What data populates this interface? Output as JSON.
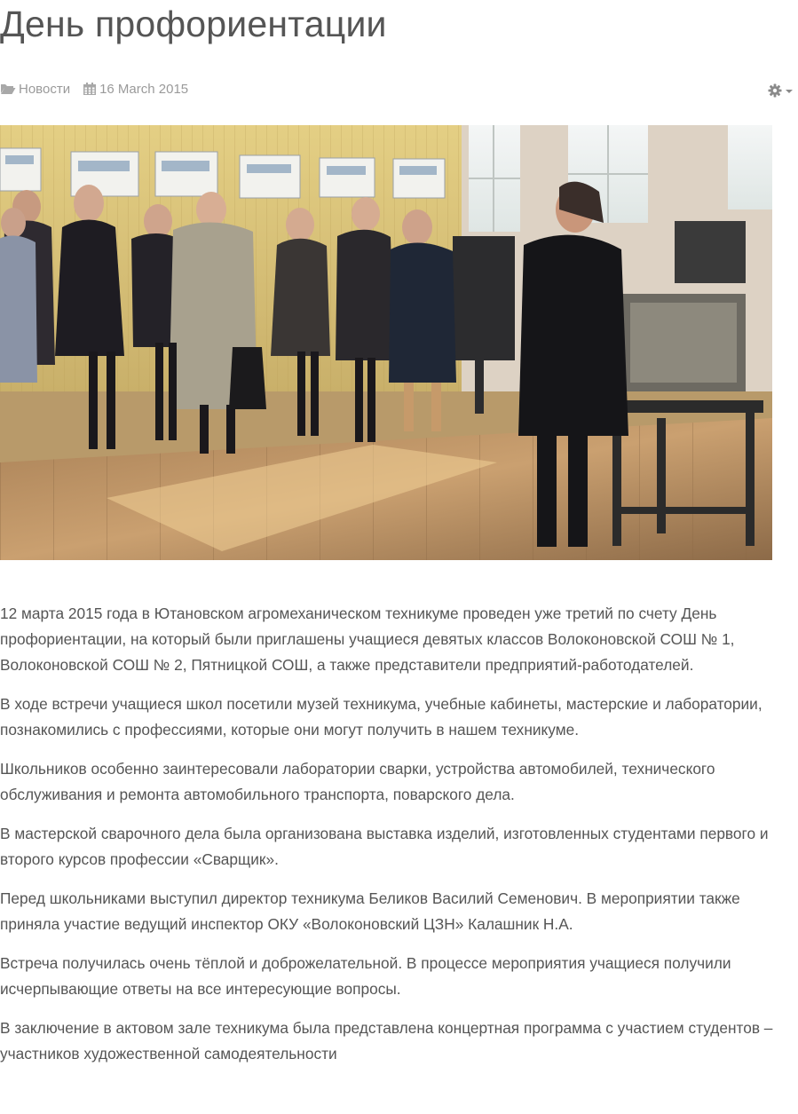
{
  "article": {
    "title": "День профориентации",
    "category": "Новости",
    "date": "16 March 2015",
    "tools_icon": "gear-icon",
    "category_icon": "folder-open-icon",
    "date_icon": "calendar-icon",
    "paragraphs": [
      "12 марта 2015 года  в Ютановском агромеханическом техникуме проведен уже третий по счету День профориентации, на который были приглашены учащиеся девятых классов Волоконовской СОШ № 1, Волоконовской СОШ № 2, Пятницкой СОШ, а также представители предприятий-работодателей.",
      "В ходе встречи учащиеся школ посетили музей техникума, учебные кабинеты, мастерские и лаборатории, познакомились с профессиями, которые они могут получить в нашем техникуме.",
      "Школьников особенно заинтересовали лаборатории сварки, устройства автомобилей, технического обслуживания и ремонта автомобильного транспорта, поварского дела.",
      "В мастерской сварочного дела была организована выставка изделий, изготовленных студентами первого и второго курсов профессии «Сварщик».",
      "Перед школьниками выступил директор техникума Беликов Василий Семенович. В мероприятии также приняла участие ведущий инспектор ОКУ «Волоконовский ЦЗН» Калашник Н.А.",
      "Встреча получилась очень тёплой и доброжелательной. В процессе мероприятия учащиеся получили исчерпывающие ответы на все интересующие вопросы.",
      "В заключение в актовом зале техникума была представлена концертная программа с участием студентов – участников художественной самодеятельности"
    ]
  },
  "colors": {
    "title": "#555555",
    "meta": "#9a9a9a",
    "body_text": "#555555"
  }
}
